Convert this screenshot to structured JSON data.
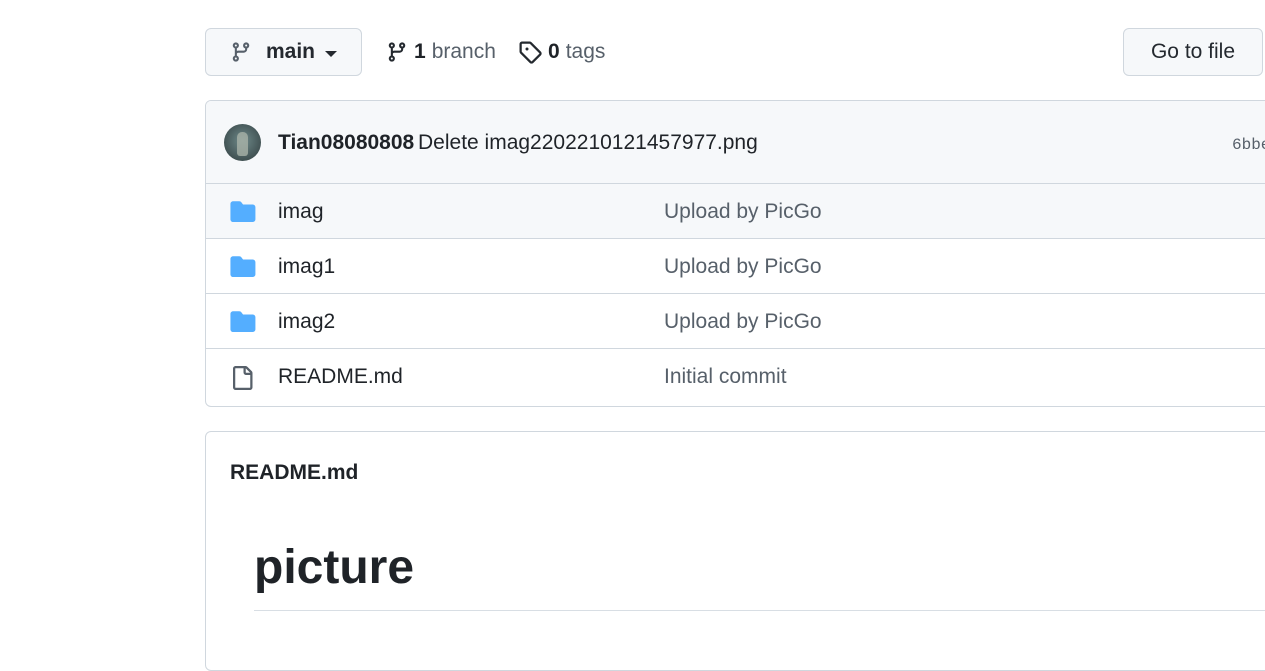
{
  "toolbar": {
    "branch_selector": "main",
    "branches_count": "1",
    "branches_word": "branch",
    "tags_count": "0",
    "tags_word": "tags",
    "goto_file": "Go to file"
  },
  "latest_commit": {
    "author": "Tian08080808",
    "message": "Delete imag2202210121457977.png",
    "sha": "6bbe"
  },
  "files": [
    {
      "type": "folder",
      "icon": "folder-icon",
      "name": "imag",
      "message": "Upload by PicGo"
    },
    {
      "type": "folder",
      "icon": "folder-icon",
      "name": "imag1",
      "message": "Upload by PicGo"
    },
    {
      "type": "folder",
      "icon": "folder-icon",
      "name": "imag2",
      "message": "Upload by PicGo"
    },
    {
      "type": "file",
      "icon": "file-icon",
      "name": "README.md",
      "message": "Initial commit"
    }
  ],
  "readme": {
    "file_name": "README.md",
    "heading": "picture"
  },
  "colors": {
    "folder": "#54aeff",
    "border": "#d0d7de",
    "muted_text": "#57606a",
    "header_bg": "#f6f8fa"
  }
}
